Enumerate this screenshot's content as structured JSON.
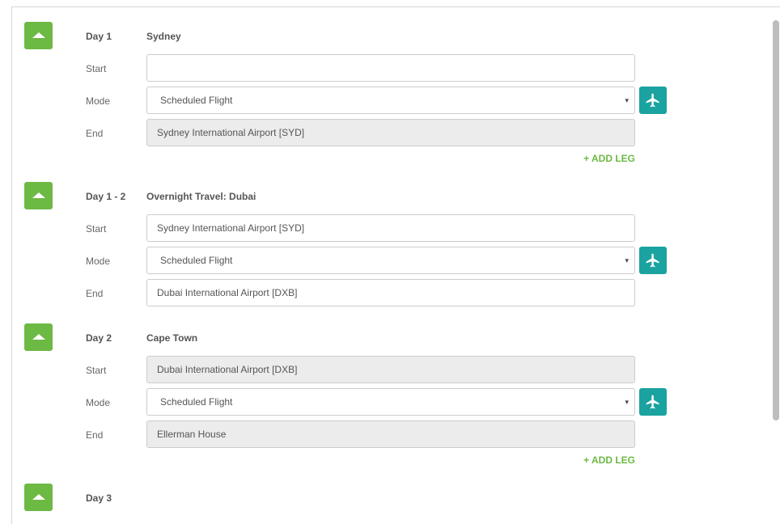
{
  "days": [
    {
      "day_label": "Day 1",
      "city": "Sydney",
      "start_label": "Start",
      "start_value": "",
      "mode_label": "Mode",
      "mode_value": "Scheduled Flight",
      "end_label": "End",
      "end_value": "Sydney International Airport [SYD]",
      "add_leg": "+ ADD LEG"
    },
    {
      "day_label": "Day 1 - 2",
      "city": "Overnight Travel: Dubai",
      "start_label": "Start",
      "start_value": "Sydney International Airport [SYD]",
      "mode_label": "Mode",
      "mode_value": "Scheduled Flight",
      "end_label": "End",
      "end_value": "Dubai International Airport [DXB]"
    },
    {
      "day_label": "Day 2",
      "city": "Cape Town",
      "start_label": "Start",
      "start_value": "Dubai International Airport [DXB]",
      "mode_label": "Mode",
      "mode_value": "Scheduled Flight",
      "end_label": "End",
      "end_value": "Ellerman House",
      "add_leg": "+ ADD LEG"
    },
    {
      "day_label": "Day 3"
    }
  ],
  "icons": {
    "collapse": "caret-up-icon",
    "mode": "airplane-icon",
    "dropdown": "chevron-down-icon"
  },
  "colors": {
    "collapse_button": "#6cb944",
    "mode_button": "#1aa3a0",
    "add_leg": "#6cb944",
    "disabled_field": "#ececec"
  },
  "dropdown_caret": "▾"
}
